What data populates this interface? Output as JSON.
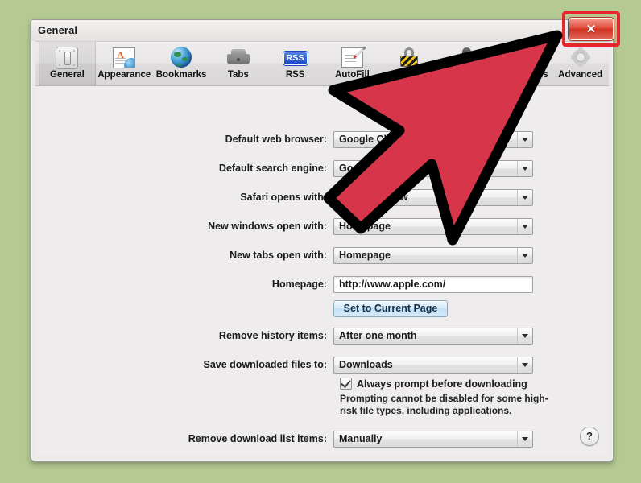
{
  "window": {
    "title": "General",
    "close_button": {
      "name": "close-button",
      "glyph": "✕",
      "highlight_color": "#e8252c"
    },
    "help_button": {
      "label": "?"
    }
  },
  "toolbar": {
    "items": [
      {
        "label": "General",
        "icon": "general-icon",
        "selected": true
      },
      {
        "label": "Appearance",
        "icon": "appearance-icon",
        "selected": false
      },
      {
        "label": "Bookmarks",
        "icon": "bookmarks-globe-icon",
        "selected": false
      },
      {
        "label": "Tabs",
        "icon": "tabs-icon",
        "selected": false
      },
      {
        "label": "RSS",
        "icon": "rss-icon",
        "selected": false,
        "icon_text": "RSS"
      },
      {
        "label": "AutoFill",
        "icon": "autofill-icon",
        "selected": false
      },
      {
        "label": "Security",
        "icon": "security-lock-icon",
        "selected": false
      },
      {
        "label": "Privacy",
        "icon": "privacy-person-icon",
        "selected": false
      },
      {
        "label": "Extensions",
        "icon": "extensions-puzzle-icon",
        "selected": false
      },
      {
        "label": "Advanced",
        "icon": "advanced-gear-icon",
        "selected": false
      }
    ]
  },
  "form": {
    "default_browser": {
      "label": "Default web browser:",
      "value": "Google Chrome",
      "type": "popup"
    },
    "default_search": {
      "label": "Default search engine:",
      "value": "Google",
      "type": "popup"
    },
    "safari_opens_with": {
      "label": "Safari opens with:",
      "value": "A new window",
      "type": "popup"
    },
    "new_windows_open_with": {
      "label": "New windows open with:",
      "value": "Homepage",
      "type": "popup"
    },
    "new_tabs_open_with": {
      "label": "New tabs open with:",
      "value": "Homepage",
      "type": "popup"
    },
    "homepage": {
      "label": "Homepage:",
      "value": "http://www.apple.com/",
      "type": "text"
    },
    "set_current_page": {
      "label": "Set to Current Page"
    },
    "remove_history": {
      "label": "Remove history items:",
      "value": "After one month",
      "type": "popup"
    },
    "save_downloads_to": {
      "label": "Save downloaded files to:",
      "value": "Downloads",
      "type": "popup"
    },
    "always_prompt": {
      "label": "Always prompt before downloading",
      "checked": true
    },
    "prompt_note": "Prompting cannot be disabled for some high-risk file types, including applications.",
    "remove_download_items": {
      "label": "Remove download list items:",
      "value": "Manually",
      "type": "popup"
    }
  },
  "cursor": {
    "name": "arrow-cursor",
    "color": "#d6354a",
    "outline": "#000000"
  },
  "colors": {
    "desktop_background": "#b4ca92",
    "window_background": "#eeecec",
    "accent_red": "#e8252c"
  }
}
